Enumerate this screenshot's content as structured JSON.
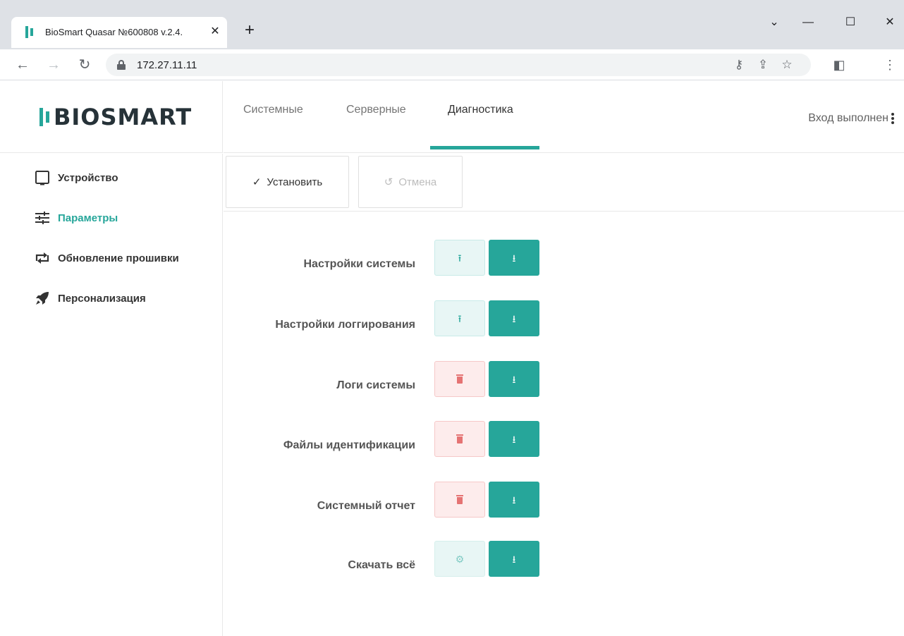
{
  "browser": {
    "tab_title": "BioSmart Quasar №600808 v.2.4.",
    "url": "172.27.11.11"
  },
  "app": {
    "logo_text": "BIOSMART",
    "topnav": {
      "tabs": [
        {
          "label": "Системные",
          "active": false
        },
        {
          "label": "Серверные",
          "active": false
        },
        {
          "label": "Диагностика",
          "active": true
        }
      ],
      "login_status": "Вход выполнен"
    },
    "sidebar": {
      "items": [
        {
          "label": "Устройство",
          "icon": "tablet-icon",
          "active": false
        },
        {
          "label": "Параметры",
          "icon": "sliders-icon",
          "active": true
        },
        {
          "label": "Обновление прошивки",
          "icon": "update-arrows-icon",
          "active": false
        },
        {
          "label": "Персонализация",
          "icon": "rocket-icon",
          "active": false
        }
      ]
    },
    "actions": {
      "apply_label": "Установить",
      "cancel_label": "Отмена"
    },
    "diagnostics": {
      "rows": [
        {
          "label": "Настройки системы",
          "left_action": "upload",
          "right_action": "download"
        },
        {
          "label": "Настройки логгирования",
          "left_action": "upload",
          "right_action": "download"
        },
        {
          "label": "Логи системы",
          "left_action": "delete",
          "right_action": "download"
        },
        {
          "label": "Файлы идентификации",
          "left_action": "delete",
          "right_action": "download"
        },
        {
          "label": "Системный отчет",
          "left_action": "delete",
          "right_action": "download"
        },
        {
          "label": "Скачать всё",
          "left_action": "settings",
          "right_action": "download"
        }
      ]
    },
    "colors": {
      "accent": "#26a69a",
      "danger": "#e57373"
    }
  }
}
